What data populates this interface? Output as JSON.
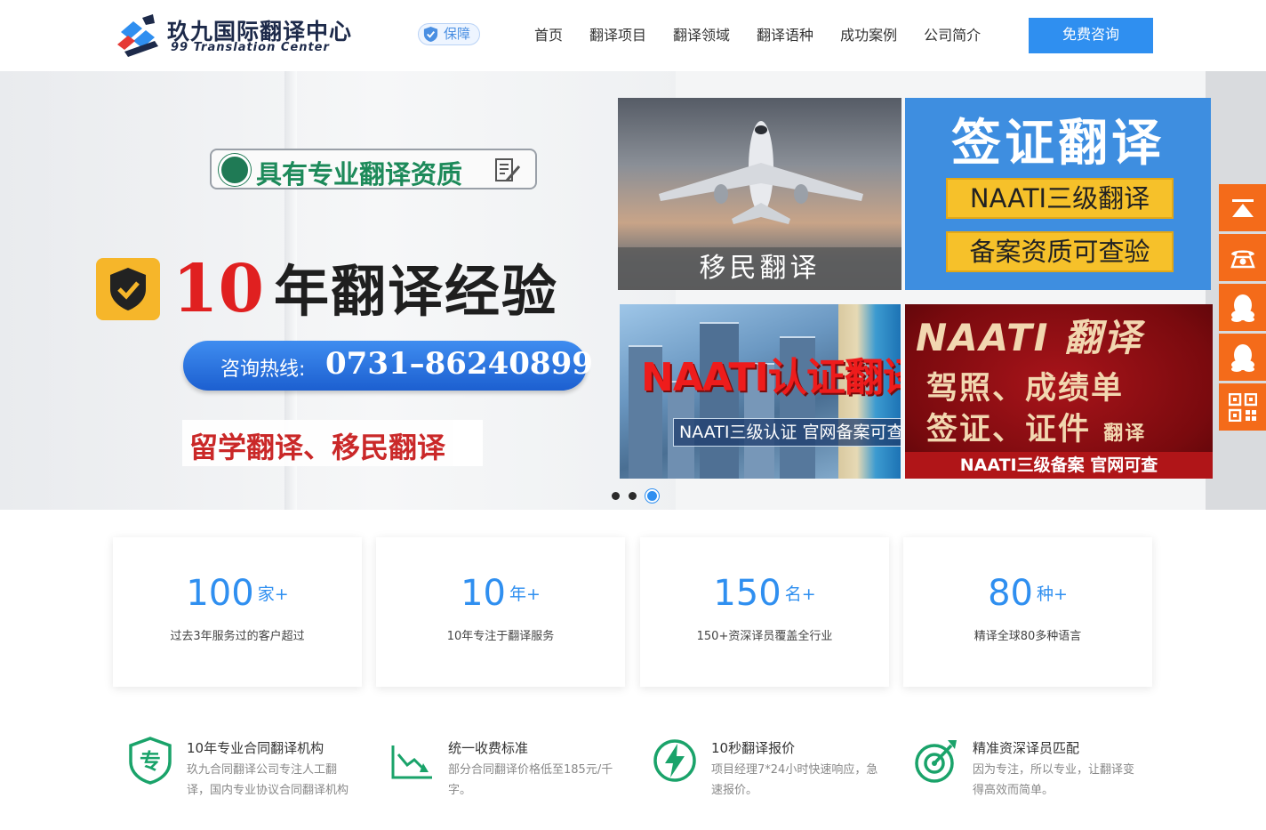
{
  "header": {
    "logo_cn": "玖九国际翻译中心",
    "logo_en": "99 Translation Center",
    "badge": "保障",
    "nav": [
      "首页",
      "翻译项目",
      "翻译领域",
      "翻译语种",
      "成功案例",
      "公司简介"
    ],
    "cta": "免费咨询"
  },
  "banner": {
    "qualification": "具有专业翻译资质",
    "years_num": "10",
    "years_text": "年翻译经验",
    "hotline_label": "咨询热线:",
    "hotline_number": "0731–86240899",
    "slogan": "留学翻译、移民翻译",
    "tile_immigration": "移民翻译",
    "tile_visa_title": "签证翻译",
    "tile_visa_bar1": "NAATI三级翻译",
    "tile_visa_bar2": "备案资质可查验",
    "tile_naati_title": "NAATI认证翻译",
    "tile_naati_sub": "NAATI三级认证 官网备案可查",
    "tile_red_line1": "NAATI 翻译",
    "tile_red_line2": "驾照、成绩单",
    "tile_red_line3": "签证、证件",
    "tile_red_line3_small": "翻译",
    "tile_red_foot": "NAATI三级备案 官网可查",
    "slide_count": 3,
    "active_slide": 3
  },
  "side_tools": [
    "back-to-top-icon",
    "phone-icon",
    "qq-icon",
    "qq-icon",
    "qr-code-icon"
  ],
  "stats": [
    {
      "num": "100",
      "unit": "家+",
      "desc": "过去3年服务过的客户超过"
    },
    {
      "num": "10",
      "unit": "年+",
      "desc": "10年专注于翻译服务"
    },
    {
      "num": "150",
      "unit": "名+",
      "desc": "150+资深译员覆盖全行业"
    },
    {
      "num": "80",
      "unit": "种+",
      "desc": "精译全球80多种语言"
    }
  ],
  "features": [
    {
      "icon": "specialist-shield-icon",
      "title": "10年专业合同翻译机构",
      "desc": "玖九合同翻译公司专注人工翻译，国内专业协议合同翻译机构"
    },
    {
      "icon": "price-chart-icon",
      "title": "统一收费标准",
      "desc": "部分合同翻译价格低至185元/千字。"
    },
    {
      "icon": "lightning-icon",
      "title": "10秒翻译报价",
      "desc": "项目经理7*24小时快速响应，急速报价。"
    },
    {
      "icon": "target-icon",
      "title": "精准资深译员匹配",
      "desc": "因为专注，所以专业，让翻译变得高效而简单。"
    }
  ],
  "colors": {
    "accent": "#2f8ff0",
    "side_tools": "#f46b1a",
    "feature_icon": "#1aa36a"
  }
}
